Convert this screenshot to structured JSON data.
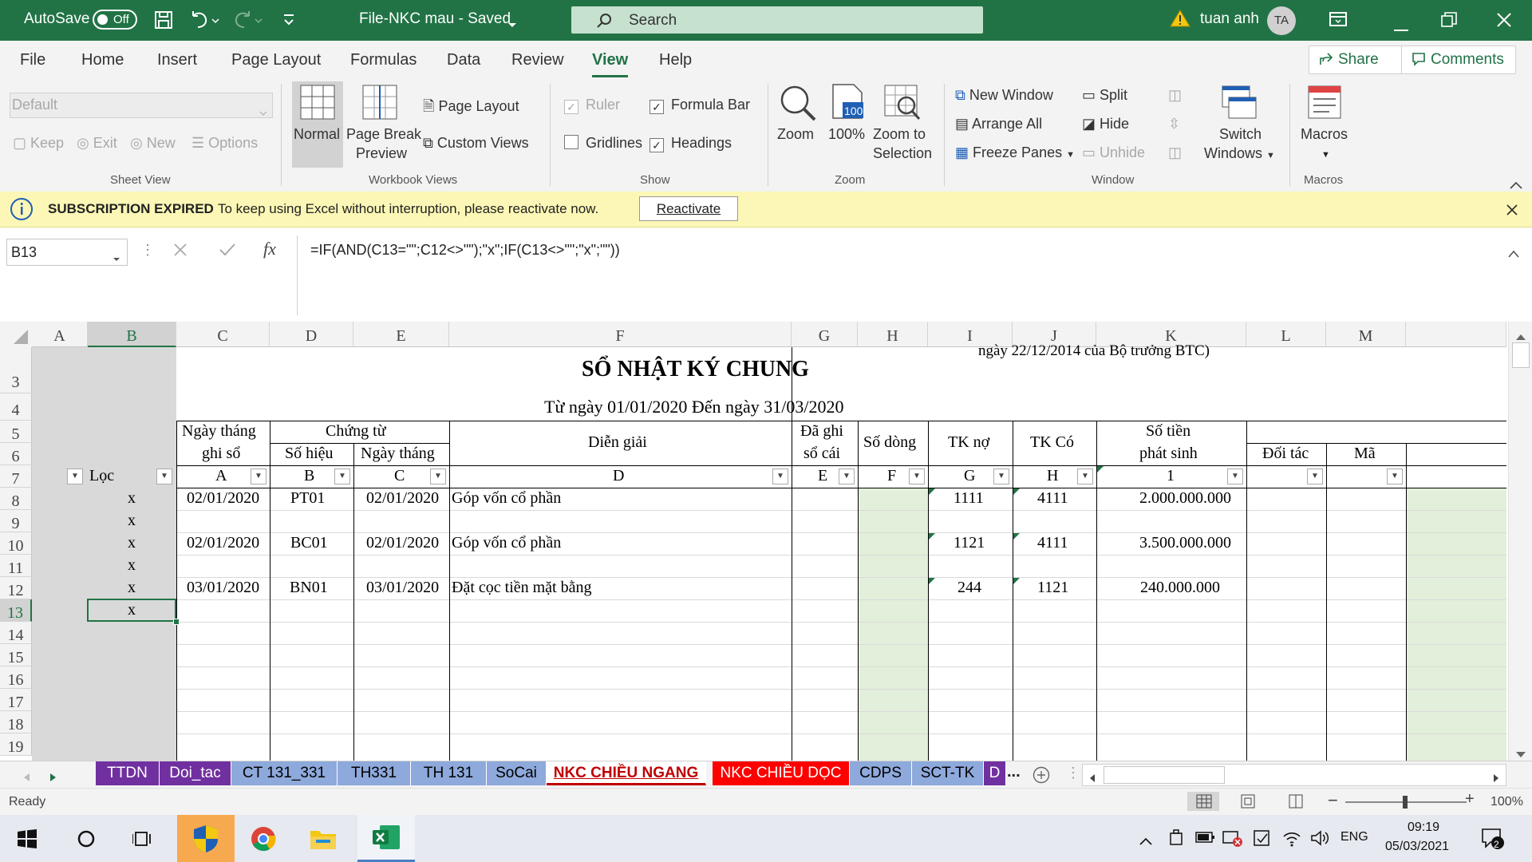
{
  "titlebar": {
    "autosave_label": "AutoSave",
    "autosave_state": "Off",
    "file_title": "File-NKC mau  -  Saved",
    "search_placeholder": "Search",
    "user_name": "tuan anh",
    "user_initials": "TA"
  },
  "menu": {
    "tabs": [
      "File",
      "Home",
      "Insert",
      "Page Layout",
      "Formulas",
      "Data",
      "Review",
      "View",
      "Help"
    ],
    "active": "View",
    "share_label": "Share",
    "comments_label": "Comments"
  },
  "ribbon": {
    "sheet_view": {
      "dropdown_value": "Default",
      "keep": "Keep",
      "exit": "Exit",
      "new": "New",
      "options": "Options",
      "group": "Sheet View"
    },
    "workbook_views": {
      "normal": "Normal",
      "page_break_1": "Page Break",
      "page_break_2": "Preview",
      "page_layout": "Page Layout",
      "custom_views": "Custom Views",
      "group": "Workbook Views"
    },
    "show": {
      "ruler": "Ruler",
      "formula_bar": "Formula Bar",
      "gridlines": "Gridlines",
      "headings": "Headings",
      "group": "Show"
    },
    "zoom": {
      "zoom": "Zoom",
      "hundred": "100%",
      "zoom_sel_1": "Zoom to",
      "zoom_sel_2": "Selection",
      "icon_text": "100",
      "group": "Zoom"
    },
    "window": {
      "new_window": "New Window",
      "arrange_all": "Arrange All",
      "freeze_panes": "Freeze Panes",
      "split": "Split",
      "hide": "Hide",
      "unhide": "Unhide",
      "switch_1": "Switch",
      "switch_2": "Windows",
      "group": "Window"
    },
    "macros": {
      "macros": "Macros",
      "group": "Macros"
    }
  },
  "message_bar": {
    "title": "SUBSCRIPTION EXPIRED",
    "text": "To keep using Excel without interruption, please reactivate now.",
    "button": "Reactivate"
  },
  "formula_bar": {
    "name_box": "B13",
    "formula": "=IF(AND(C13=\"\";C12<>\"\");\"x\";IF(C13<>\"\";\"x\";\"\"))"
  },
  "sheet": {
    "columns": [
      "A",
      "B",
      "C",
      "D",
      "E",
      "F",
      "G",
      "H",
      "I",
      "J",
      "K",
      "L",
      "M"
    ],
    "rows": [
      "3",
      "4",
      "5",
      "6",
      "7",
      "8",
      "9",
      "10",
      "11",
      "12",
      "13",
      "14",
      "15",
      "16",
      "17",
      "18",
      "19"
    ],
    "cut_text": "ngày 22/12/2014 của Bộ trưởng BTC)",
    "title": "SỔ NHẬT KÝ CHUNG",
    "period": "Từ ngày 01/01/2020   Đến ngày 31/03/2020",
    "headers": {
      "ngay_ghi_so_1": "Ngày tháng",
      "ngay_ghi_so_2": "ghi sổ",
      "chung_tu": "Chứng từ",
      "so_hieu": "Số hiệu",
      "ngay_thang": "Ngày tháng",
      "dien_giai": "Diễn giải",
      "da_ghi_1": "Đã ghi",
      "da_ghi_2": "sổ cái",
      "so_dong": "Số dòng",
      "tk_no": "TK nợ",
      "tk_co": "TK Có",
      "so_tien_1": "Số tiền",
      "so_tien_2": "phát sinh",
      "doi_tac": "Đối tác",
      "ma": "Mã"
    },
    "row7": {
      "loc": "Lọc",
      "c": "A",
      "d": "B",
      "e": "C",
      "f": "D",
      "g": "E",
      "h": "F",
      "i": "G",
      "j": "H",
      "k": "1"
    },
    "entries": [
      {
        "row": "8",
        "b": "x",
        "c": "02/01/2020",
        "d": "PT01",
        "e": "02/01/2020",
        "f": "Góp vốn cổ phần",
        "i": "1111",
        "j": "4111",
        "k": "2.000.000.000"
      },
      {
        "row": "9",
        "b": "x",
        "c": "",
        "d": "",
        "e": "",
        "f": "",
        "i": "",
        "j": "",
        "k": ""
      },
      {
        "row": "10",
        "b": "x",
        "c": "02/01/2020",
        "d": "BC01",
        "e": "02/01/2020",
        "f": "Góp vốn cổ phần",
        "i": "1121",
        "j": "4111",
        "k": "3.500.000.000"
      },
      {
        "row": "11",
        "b": "x",
        "c": "",
        "d": "",
        "e": "",
        "f": "",
        "i": "",
        "j": "",
        "k": ""
      },
      {
        "row": "12",
        "b": "x",
        "c": "03/01/2020",
        "d": "BN01",
        "e": "03/01/2020",
        "f": "Đặt cọc tiền mặt bằng",
        "i": "244",
        "j": "1121",
        "k": "240.000.000"
      },
      {
        "row": "13",
        "b": "x",
        "c": "",
        "d": "",
        "e": "",
        "f": "",
        "i": "",
        "j": "",
        "k": ""
      }
    ]
  },
  "sheet_tabs": {
    "items": [
      {
        "label": "TTDN",
        "bg": "#7030a0",
        "fg": "#ffffff"
      },
      {
        "label": "Doi_tac",
        "bg": "#7030a0",
        "fg": "#ffffff"
      },
      {
        "label": "CT 131_331",
        "bg": "#8ea9db",
        "fg": "#000000"
      },
      {
        "label": "TH331",
        "bg": "#8ea9db",
        "fg": "#000000"
      },
      {
        "label": "TH 131",
        "bg": "#8ea9db",
        "fg": "#000000"
      },
      {
        "label": "SoCai",
        "bg": "#8ea9db",
        "fg": "#000000"
      },
      {
        "label": "NKC CHIỀU NGANG",
        "bg": "#ffffff",
        "fg": "#c00000"
      },
      {
        "label": "NKC CHIỀU DỌC",
        "bg": "#ff0000",
        "fg": "#ffffff"
      },
      {
        "label": "CDPS",
        "bg": "#8ea9db",
        "fg": "#000000"
      },
      {
        "label": "SCT-TK",
        "bg": "#8ea9db",
        "fg": "#000000"
      },
      {
        "label": "D",
        "bg": "#7030a0",
        "fg": "#ffffff"
      }
    ],
    "active": "NKC CHIỀU NGANG",
    "more": "..."
  },
  "status": {
    "ready": "Ready",
    "zoom": "100%"
  },
  "taskbar": {
    "lang": "ENG",
    "time": "09:19",
    "date": "05/03/2021",
    "notif_count": "2"
  },
  "colors": {
    "excel_green": "#217346",
    "msg_bar": "#fcf7b6",
    "f_column_fill": "#e2efda"
  }
}
